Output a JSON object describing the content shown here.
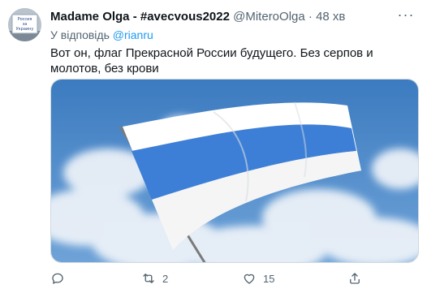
{
  "tweet": {
    "author_name": "Madame Olga - #avecvous2022",
    "author_handle": "@MiteroOlga",
    "time": "48 хв",
    "more_label": "···",
    "reply_prefix": "У відповідь ",
    "reply_to": "@rianru",
    "text": "Вот он, флаг Прекрасной России будущего.  Без серпов и молотов, без крови",
    "avatar_sign_text": [
      "Россия",
      "за",
      "Украину"
    ]
  },
  "actions": {
    "reply_count": "",
    "retweet_count": "2",
    "like_count": "15",
    "share_count": ""
  },
  "colors": {
    "flag_blue": "#3d7fd6",
    "sky_blue": "#4b87c6",
    "link": "#1d9bf0",
    "muted": "#536471"
  }
}
